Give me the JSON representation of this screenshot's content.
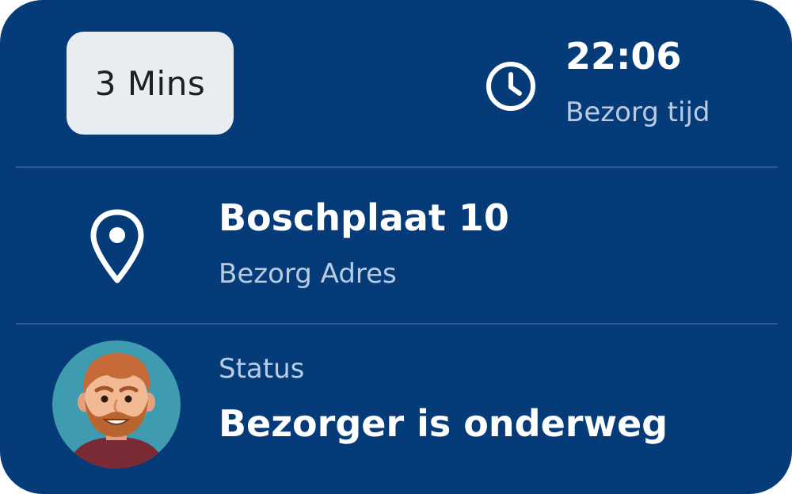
{
  "eta": {
    "label": "3 Mins"
  },
  "delivery_time": {
    "value": "22:06",
    "label": "Bezorg tijd",
    "icon": "clock-icon"
  },
  "address": {
    "value": "Boschplaat 10",
    "label": "Bezorg Adres",
    "icon": "location-pin-icon"
  },
  "status": {
    "label": "Status",
    "value": "Bezorger is onderweg",
    "avatar": "courier-avatar"
  },
  "colors": {
    "card_background": "#063b7a",
    "divider": "#2a5a91",
    "pill_background": "#e8edf2",
    "primary_text": "#ffffff",
    "secondary_text": "#b8cce4"
  }
}
